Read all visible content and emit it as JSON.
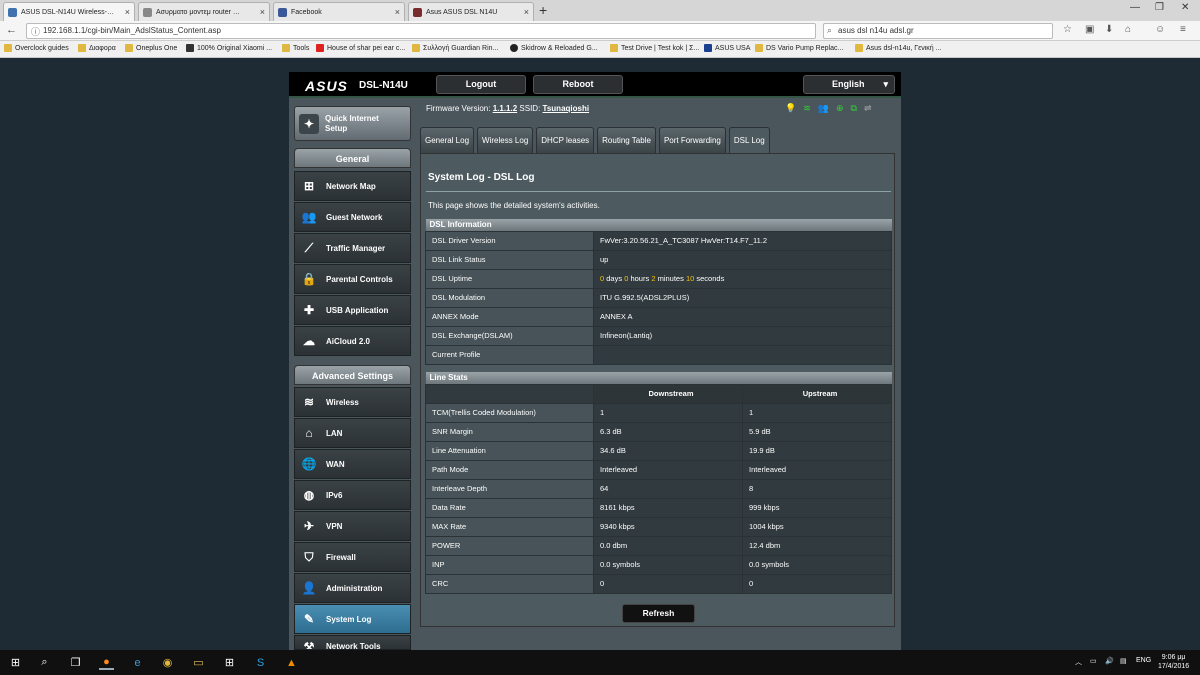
{
  "browser": {
    "tabs": [
      {
        "label": "ASUS DSL-N14U Wireless-…",
        "color": "#3f72af"
      },
      {
        "label": "Ασυρματο μοντεμ router …",
        "color": "#888888"
      },
      {
        "label": "Facebook",
        "color": "#3b5998"
      },
      {
        "label": "Asus ASUS DSL N14U",
        "color": "#7a2b2b"
      }
    ],
    "url": "192.168.1.1/cgi-bin/Main_AdslStatus_Content.asp",
    "search": "asus dsl n14u adsl.gr",
    "bookmarks": [
      "Overclock guides",
      "Διαφορα",
      "Oneplus One",
      "100% Original Xiaomi ...",
      "Tools",
      "House of shar pei ear c...",
      "Συλλογή Guardian Rin...",
      "Skidrow & Reloaded G...",
      "Test Drive | Test kok | Σ...",
      "ASUS USA",
      "DS Vario Pump Replac...",
      "Asus dsl-n14u, Γενική ..."
    ]
  },
  "router": {
    "brand": "ASUS",
    "model": "DSL-N14U",
    "logout": "Logout",
    "reboot": "Reboot",
    "language": "English",
    "firmware_label": "Firmware Version:",
    "firmware": "1.1.1.2",
    "ssid_label": "SSID:",
    "ssid": "Tsunaqioshi",
    "qis": "Quick Internet Setup",
    "general": "General",
    "general_items": [
      "Network Map",
      "Guest Network",
      "Traffic Manager",
      "Parental Controls",
      "USB Application",
      "AiCloud 2.0"
    ],
    "advanced": "Advanced Settings",
    "advanced_items": [
      "Wireless",
      "LAN",
      "WAN",
      "IPv6",
      "VPN",
      "Firewall",
      "Administration",
      "System Log",
      "Network Tools"
    ],
    "tabs": [
      "General Log",
      "Wireless Log",
      "DHCP leases",
      "Routing Table",
      "Port Forwarding",
      "DSL Log"
    ],
    "title": "System Log - DSL Log",
    "desc": "This page shows the detailed system's activities.",
    "dsl_info_header": "DSL Information",
    "dsl_info": [
      [
        "DSL Driver Version",
        "FwVer:3.20.56.21_A_TC3087 HwVer:T14.F7_11.2"
      ],
      [
        "DSL Link Status",
        "up"
      ],
      [
        "DSL Uptime",
        ""
      ],
      [
        "DSL Modulation",
        "ITU G.992.5(ADSL2PLUS)"
      ],
      [
        "ANNEX Mode",
        "ANNEX A"
      ],
      [
        "DSL Exchange(DSLAM)",
        "Infineon(Lantiq)"
      ],
      [
        "Current Profile",
        ""
      ]
    ],
    "uptime": {
      "days": "0",
      "days_label": "days",
      "hours": "0",
      "hours_label": "hours",
      "minutes": "2",
      "minutes_label": "minutes",
      "seconds": "10",
      "seconds_label": "seconds"
    },
    "line_stats_header": "Line Stats",
    "downstream": "Downstream",
    "upstream": "Upstream",
    "line_stats": [
      [
        "TCM(Trellis Coded Modulation)",
        "1",
        "1"
      ],
      [
        "SNR Margin",
        "6.3 dB",
        "5.9 dB"
      ],
      [
        "Line Attenuation",
        "34.6 dB",
        "19.9 dB"
      ],
      [
        "Path Mode",
        "Interleaved",
        "Interleaved"
      ],
      [
        "Interleave Depth",
        "64",
        "8"
      ],
      [
        "Data Rate",
        "8161 kbps",
        "999 kbps"
      ],
      [
        "MAX Rate",
        "9340 kbps",
        "1004 kbps"
      ],
      [
        "POWER",
        "0.0 dbm",
        "12.4 dbm"
      ],
      [
        "INP",
        "0.0 symbols",
        "0.0 symbols"
      ],
      [
        "CRC",
        "0",
        "0"
      ]
    ],
    "refresh": "Refresh"
  },
  "taskbar": {
    "lang": "ENG",
    "time": "9:06 μμ",
    "date": "17/4/2016"
  }
}
